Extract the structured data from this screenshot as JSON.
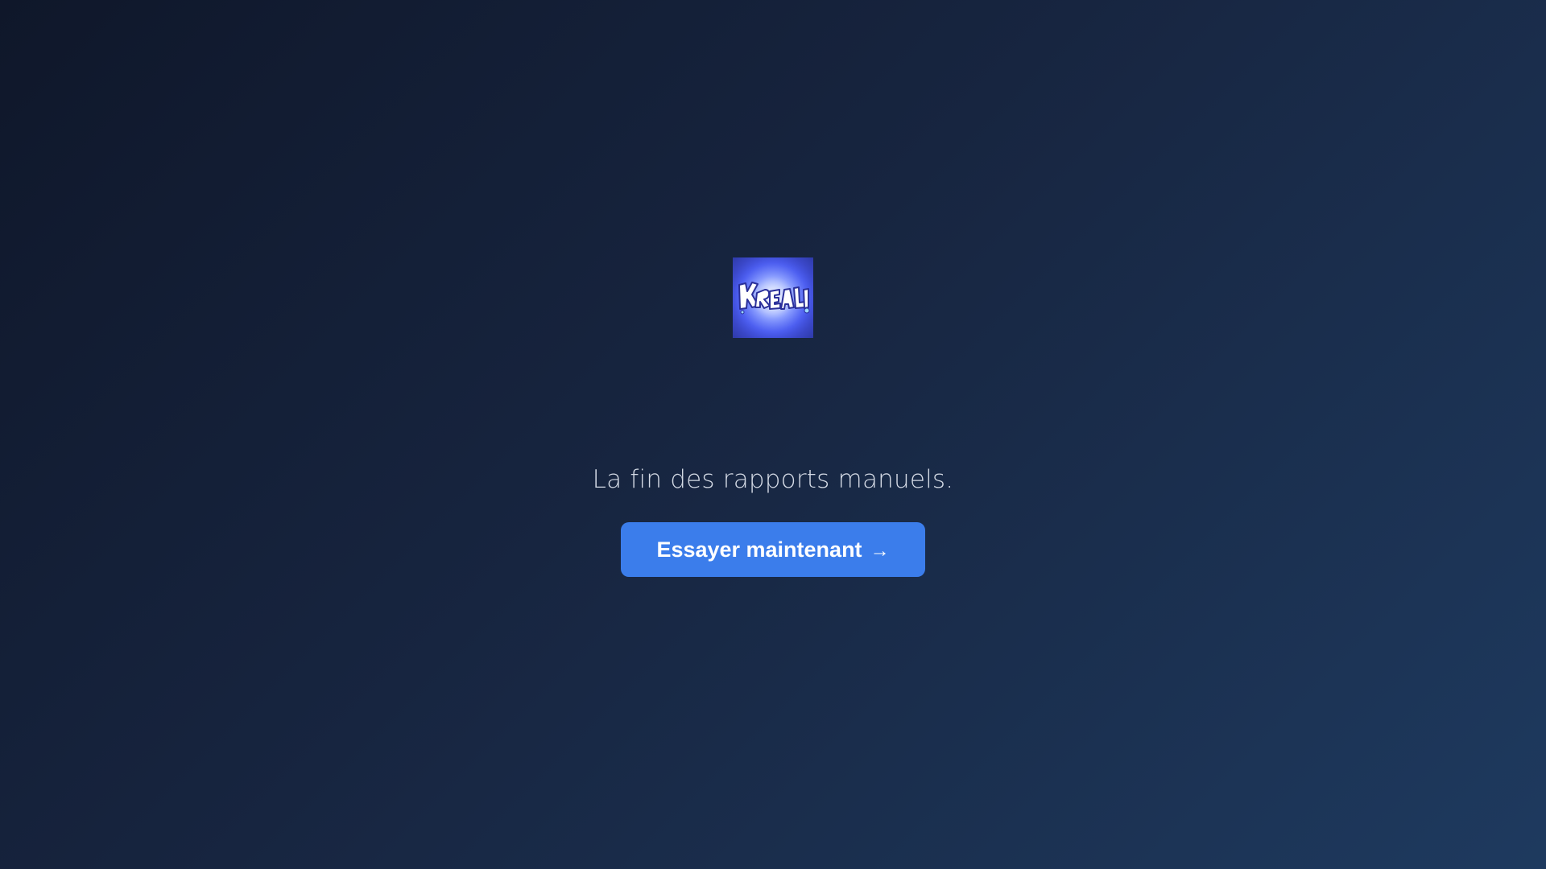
{
  "logo": {
    "icon": "graffiti-logo-icon",
    "text": "Krealia"
  },
  "hero": {
    "tagline": "La fin des rapports manuels.",
    "cta_label": "Essayer maintenant",
    "cta_arrow": "→"
  },
  "colors": {
    "background_start": "#0f172a",
    "background_end": "#1e3a5f",
    "accent": "#3b7deb",
    "tagline_text": "#d5dbe6",
    "button_text": "#ffffff"
  }
}
